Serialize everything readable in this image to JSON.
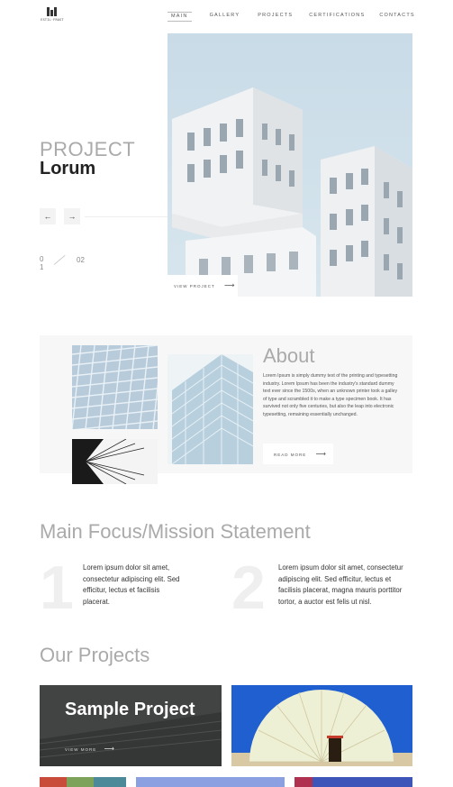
{
  "header": {
    "logo_text": "ESTIL·FRAST",
    "nav": [
      {
        "label": "MAIN",
        "active": true
      },
      {
        "label": "GALLERY"
      },
      {
        "label": "PROJECTS"
      },
      {
        "label": "CERTIFICATIONS"
      },
      {
        "label": "CONTACTS"
      }
    ]
  },
  "hero": {
    "kicker": "PROJECT",
    "title": "Lorum",
    "prev_icon": "arrow-left-icon",
    "next_icon": "arrow-right-icon",
    "prev_glyph": "←",
    "next_glyph": "→",
    "counter_current": "0 1",
    "counter_total": "02",
    "view_project_label": "VIEW PROJECT",
    "arrow_glyph": "⟶"
  },
  "about": {
    "title": "About",
    "text": "Lorem Ipsum is simply dummy text of the printing and typesetting industry. Lorem Ipsum has been the industry's standard dummy text ever since the 1500s, when an unknown printer took a galley of type and scrambled it to make a type specimen book. It has survived not only five centuries, but also the leap into electronic typesetting, remaining essentially unchanged.",
    "read_more_label": "READ MORE",
    "arrow_glyph": "⟶"
  },
  "mission": {
    "title": "Main Focus/Mission Statement",
    "items": [
      {
        "number": "1",
        "text": "Lorem ipsum dolor sit amet, consectetur adipiscing elit. Sed efficitur, lectus et facilisis placerat."
      },
      {
        "number": "2",
        "text": "Lorem ipsum dolor sit amet, consectetur adipiscing elit. Sed efficitur, lectus et facilisis placerat, magna mauris porttitor tortor, a auctor est felis ut nisl."
      }
    ]
  },
  "projects": {
    "title": "Our Projects",
    "featured_title": "Sample Project",
    "featured_link": "VIEW MORE",
    "arrow_glyph": "⟶"
  },
  "colors": {
    "accent_grey": "#aaaaaa",
    "text_dark": "#222222",
    "panel_bg": "#f7f7f7"
  }
}
